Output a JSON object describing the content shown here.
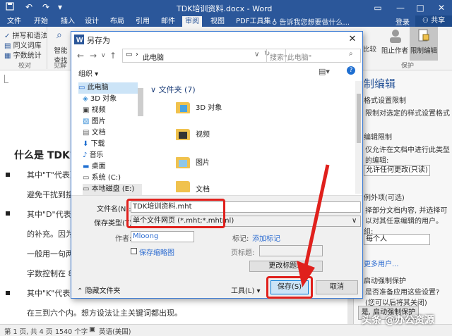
{
  "window": {
    "title": "TDK培训资料.docx - Word",
    "login": "登录",
    "share": "共享",
    "tell_me": "告诉我您想要做什么..."
  },
  "tabs": [
    "文件",
    "开始",
    "插入",
    "设计",
    "布局",
    "引用",
    "邮件",
    "审阅",
    "视图",
    "PDF工具集"
  ],
  "active_tab": "审阅",
  "ribbon": {
    "left_items": [
      "拼写和语法",
      "同义词库",
      "字数统计"
    ],
    "group_proofing": "校对",
    "smart_lookup": "智能\n查找",
    "group_insights": "见解",
    "right_items": [
      "比较",
      "阻止作者",
      "限制编辑"
    ],
    "group_protect": "保护"
  },
  "document": {
    "heading": "什么是 TDK?",
    "lines": [
      "其中\"T\"代表页",
      "避免干扰到搜",
      "其中\"D\"代表页",
      "的补充。因为",
      "一般用一句两",
      "字数控制在 80",
      "其中\"K\"代表关",
      "在三到六个内。想方设法让主关键词都出现。"
    ]
  },
  "pane": {
    "title": "制编辑",
    "sec1": "格式设置限制",
    "sec1_text": "限制对选定的样式设置格式",
    "sec2": "编辑限制",
    "sec2_text": "仅允许在文档中进行此类型的编辑:",
    "dropdown": "允许任何更改(只读)",
    "sec3": "例外项(可选)",
    "sec3_text": "择部分文档内容, 并选择可以对其任意编辑的用户。",
    "group": "组:",
    "everyone": "每个人",
    "more_users": "更多用户...",
    "sec4": "启动强制保护",
    "sec4_text": "是否准备应用这些设置? (您可以后将其关闭)",
    "enforce_btn": "是, 启动强制保护"
  },
  "status": {
    "page": "第 1 页, 共 4 页",
    "words": "1540 个字",
    "lang": "英语(美国)"
  },
  "dialog": {
    "title": "另存为",
    "path": "此电脑",
    "search_placeholder": "搜索\"此电脑\"",
    "organize": "组织 ▾",
    "nav_items": [
      {
        "label": "此电脑",
        "icon": "computer-icon",
        "selected": true
      },
      {
        "label": "3D 对象",
        "icon": "3d-objects-icon"
      },
      {
        "label": "视频",
        "icon": "video-icon"
      },
      {
        "label": "图片",
        "icon": "pictures-icon"
      },
      {
        "label": "文档",
        "icon": "documents-icon"
      },
      {
        "label": "下载",
        "icon": "download-icon"
      },
      {
        "label": "音乐",
        "icon": "music-icon"
      },
      {
        "label": "桌面",
        "icon": "desktop-icon"
      },
      {
        "label": "系统 (C:)",
        "icon": "drive-icon"
      },
      {
        "label": "本地磁盘 (E:)",
        "icon": "drive-icon"
      }
    ],
    "folders_header": "文件夹 (7)",
    "folders": [
      "3D 对象",
      "视频",
      "图片",
      "文档"
    ],
    "filename_label": "文件名(N):",
    "filename": "TDK培训资料.mht",
    "filetype_label": "保存类型(T):",
    "filetype": "单个文件网页 (*.mht;*.mhtml)",
    "author_label": "作者:",
    "author": "Mloong",
    "tags_label": "标记:",
    "tags_link": "添加标记",
    "thumbnail": "保存缩略图",
    "page_title_label": "页标题:",
    "change_title": "更改标题...",
    "hide_folders": "隐藏文件夹",
    "tools": "工具(L)",
    "save": "保存(S)",
    "cancel": "取消"
  },
  "watermark": "头条 @办公资源",
  "colors": {
    "word_blue": "#2b579a",
    "highlight_red": "#e0201c",
    "folder_yellow": "#f0c24e"
  }
}
